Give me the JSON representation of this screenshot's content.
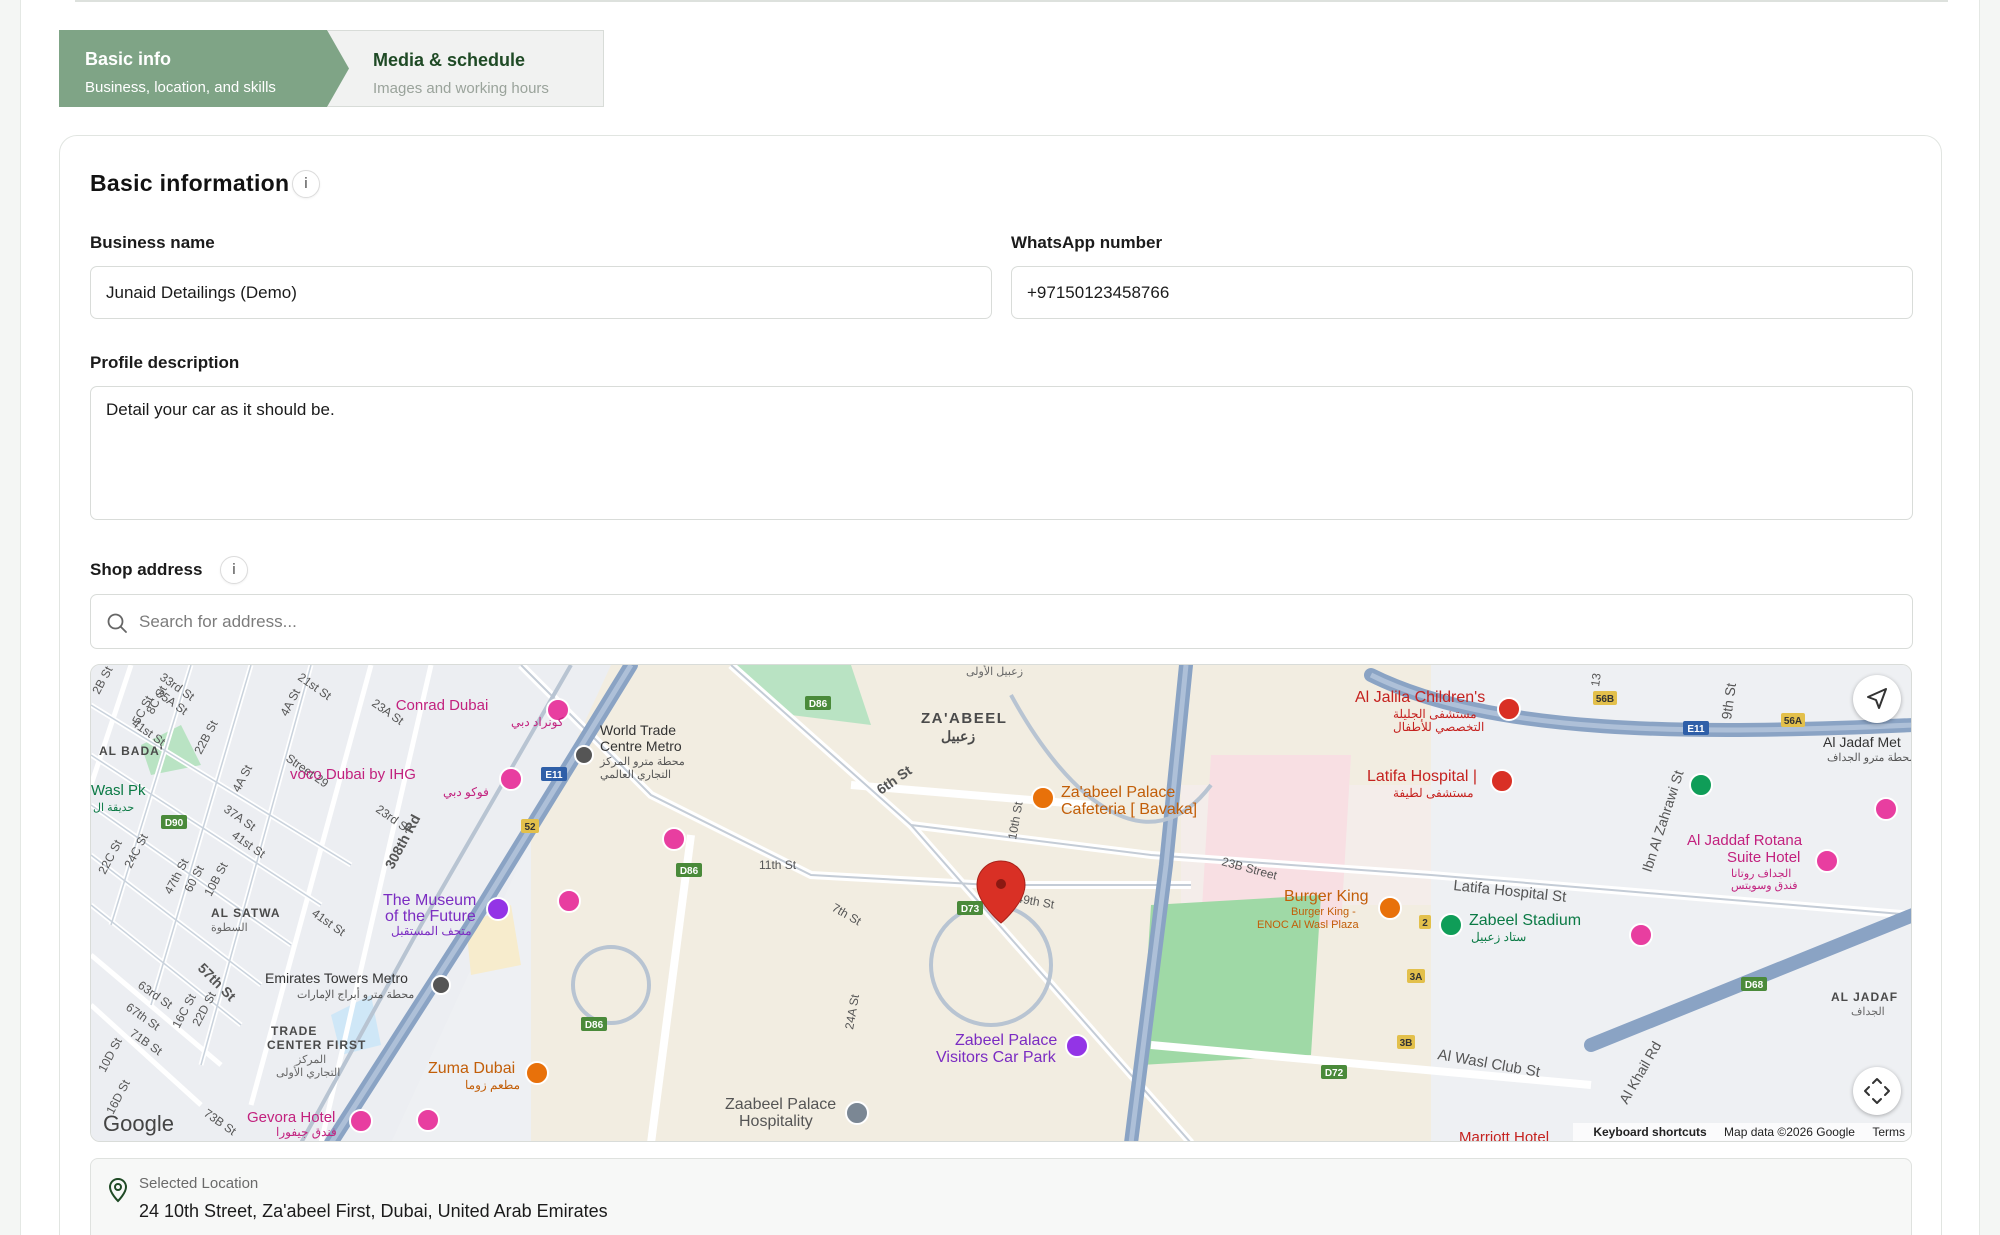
{
  "stepper": {
    "steps": [
      {
        "title": "Basic info",
        "subtitle": "Business, location, and skills"
      },
      {
        "title": "Media & schedule",
        "subtitle": "Images and working hours"
      }
    ]
  },
  "section": {
    "title": "Basic information",
    "info_glyph": "i"
  },
  "form": {
    "business_name_label": "Business name",
    "business_name_value": "Junaid Detailings (Demo)",
    "whatsapp_label": "WhatsApp number",
    "whatsapp_value": "+97150123458766",
    "description_label": "Profile description",
    "description_value": "Detail your car as it should be.",
    "address_label": "Shop address",
    "address_info_glyph": "i",
    "search_placeholder": "Search for address..."
  },
  "map": {
    "labels": {
      "zaabeel_en": "ZA'ABEEL",
      "zaabeel_ar": "زعبيل",
      "conrad": "Conrad Dubai",
      "conrad_ar": "كونراد دبي",
      "voco": "voco Dubai by IHG",
      "voco_ar": "فوكو دبي",
      "wtc_metro_1": "World Trade",
      "wtc_metro_2": "Centre Metro",
      "wtc_metro_ar1": "محطة مترو المركز",
      "wtc_metro_ar2": "التجاري العالمي",
      "museum_1": "The Museum",
      "museum_2": "of the Future",
      "museum_ar": "متحف المستقبل",
      "emirates_towers": "Emirates Towers Metro",
      "emirates_towers_ar": "محطة مترو أبراج الإمارات",
      "trade_centre_1": "TRADE",
      "trade_centre_2": "CENTER FIRST",
      "trade_centre_ar1": "المركز",
      "trade_centre_ar2": "التجاري الأولى",
      "zuma": "Zuma Dubai",
      "zuma_ar": "مطعم زوما",
      "gevora": "Gevora Hotel",
      "gevora_ar": "فندق جيفورا",
      "al_satwa": "AL SATWA",
      "al_satwa_ar": "السطوة",
      "al_bada": "AL BADA'",
      "wasl_pk": "Wasl Pk",
      "wasl_pk_ar": "حديقة ال",
      "palace_cafe_1": "Za'abeel Palace",
      "palace_cafe_2": "Cafeteria [ Bavaka]",
      "burger_king": "Burger King",
      "burger_king_2": "Burger King -",
      "burger_king_3": "ENOC Al Wasl Plaza",
      "zabeel_palace_1": "Zabeel Palace",
      "zabeel_palace_2": "Visitors Car Park",
      "zaabeel_hosp_1": "Zaabeel Palace",
      "zaabeel_hosp_2": "Hospitality",
      "jalila_1": "Al Jalila Children's",
      "jalila_ar1": "مستشفى الجليلة",
      "jalila_ar2": "التخصصي للأطفال",
      "latifa": "Latifa Hospital |",
      "latifa_ar": "مستشفى لطيفة",
      "zabeel_stadium": "Zabeel Stadium",
      "zabeel_stadium_ar": "ستاد زعبيل",
      "rotana_1": "Al Jaddaf Rotana",
      "rotana_2": "Suite Hotel",
      "rotana_ar1": "الجداف روتانا",
      "rotana_ar2": "فندق وسويتس",
      "al_jadaf_metro": "Al Jadaf Met",
      "al_jadaf_metro_ar": "محطة مترو الجداف",
      "al_jadaf": "AL JADAF",
      "al_jadaf_ar": "الجداف",
      "marriott": "Marriott Hotel",
      "zaabeel_first_ar": "زعبيل الأولى",
      "st_6th": "6th St",
      "st_10th": "10th St",
      "st_11th": "11th St",
      "st_7th": "7th St",
      "st_49th": "49th St",
      "st_24a": "24A St",
      "st_23b": "23B Street",
      "latifa_hosp_st": "Latifa Hospital St",
      "al_wasl_club": "Al Wasl Club St",
      "al_khail": "Al Khail Rd",
      "ibn_al_zahrawi": "Ibn Al Zahrawi St",
      "st_9th": "9th St",
      "st_13": "13",
      "st_308": "308th Rd",
      "st_57th": "57th St",
      "st_street29": "Street 29",
      "st_23a": "23A St",
      "st_21st": "21st St",
      "st_4a": "4A St",
      "st_23rd": "23rd St",
      "st_41st": "41st St",
      "st_37a": "37A St",
      "st_10b": "10B St",
      "st_60": "60 St",
      "st_47th": "47th St",
      "st_22c": "22C St",
      "st_24c": "24C St",
      "st_63rd": "63rd St",
      "st_67th": "67th St",
      "st_71b": "71B St",
      "st_22d": "22D St",
      "st_16c": "16C St",
      "st_10d": "10D St",
      "st_16d": "16D St",
      "st_73b": "73B St",
      "st_5c": "5C St",
      "st_8c": "8C St",
      "st_33rd": "33rd St",
      "st_35a": "35A St",
      "st_41st_b": "41st St",
      "st_22b": "22B St",
      "st_28": "2B St",
      "st_4a_b": "4A St",
      "st_41st_c": "41st St"
    },
    "shields": [
      "D86",
      "D86",
      "D86",
      "D73",
      "D72",
      "D90",
      "D68",
      "E11",
      "E11",
      "52",
      "56B",
      "56A",
      "3A",
      "3B",
      "2"
    ],
    "google": "Google",
    "footer": {
      "shortcuts": "Keyboard shortcuts",
      "data": "Map data ©2026 Google",
      "terms": "Terms"
    },
    "colors": {
      "water": "#aadaff",
      "park": "#c8e6c9",
      "hotel": "#e83ea0",
      "food": "#e8710a",
      "hospital": "#d93025",
      "museum": "#9334e6",
      "highway": "#7a95b8",
      "pin": "#d93025"
    }
  },
  "selected": {
    "label": "Selected Location",
    "address": "24 10th Street, Za'abeel First, Dubai, United Arab Emirates"
  },
  "colors": {
    "accent_green": "#7fa486",
    "dark_green": "#1f4a25"
  }
}
